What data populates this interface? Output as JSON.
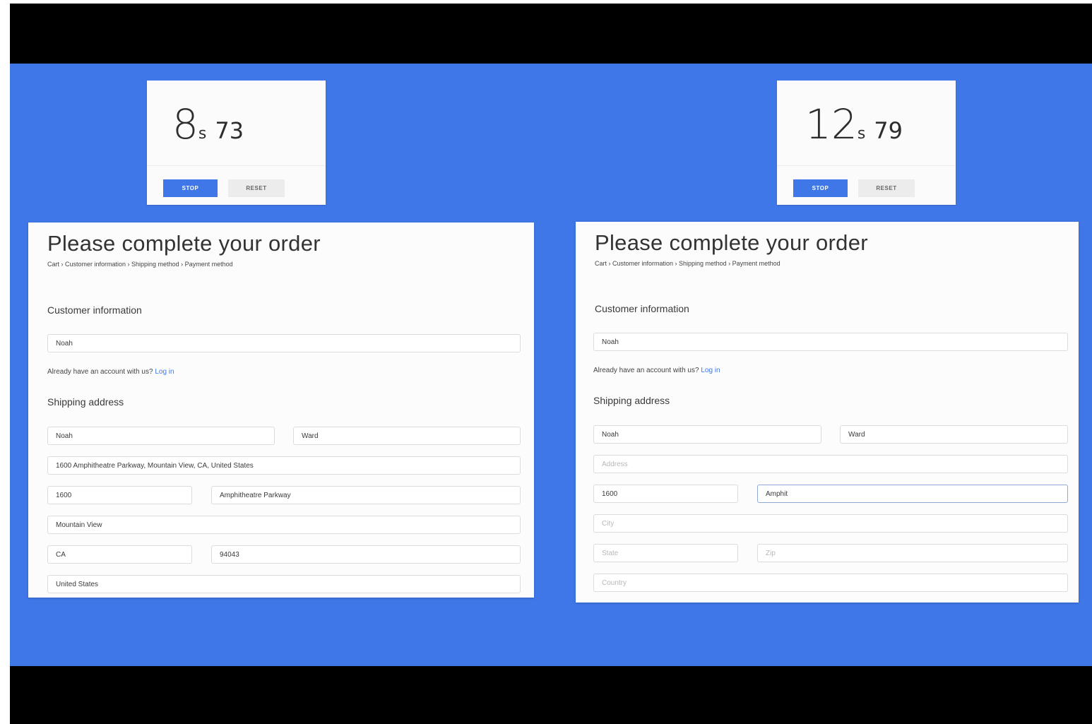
{
  "left": {
    "timer": {
      "seconds": "8",
      "unit": "s",
      "centis": "73",
      "stop_label": "STOP",
      "reset_label": "RESET"
    },
    "form": {
      "title": "Please complete your order",
      "breadcrumb": "Cart › Customer information › Shipping method › Payment method",
      "customer_section": "Customer information",
      "email_value": "Noah",
      "account_text": "Already have an account with us?",
      "login_link": "Log in",
      "shipping_section": "Shipping address",
      "first_name": "Noah",
      "last_name": "Ward",
      "address": "1600 Amphitheatre Parkway, Mountain View, CA, United States",
      "street_number": "1600",
      "street_name": "Amphitheatre Parkway",
      "city": "Mountain View",
      "state": "CA",
      "zip": "94043",
      "country": "United States"
    }
  },
  "right": {
    "timer": {
      "seconds": "12",
      "unit": "s",
      "centis": "79",
      "stop_label": "STOP",
      "reset_label": "RESET"
    },
    "form": {
      "title": "Please complete your order",
      "breadcrumb": "Cart › Customer information › Shipping method › Payment method",
      "customer_section": "Customer information",
      "email_value": "Noah",
      "account_text": "Already have an account with us?",
      "login_link": "Log in",
      "shipping_section": "Shipping address",
      "first_name": "Noah",
      "last_name": "Ward",
      "address_placeholder": "Address",
      "street_number": "1600",
      "street_name": "Amphit",
      "city_placeholder": "City",
      "state_placeholder": "State",
      "zip_placeholder": "Zip",
      "country_placeholder": "Country"
    }
  }
}
